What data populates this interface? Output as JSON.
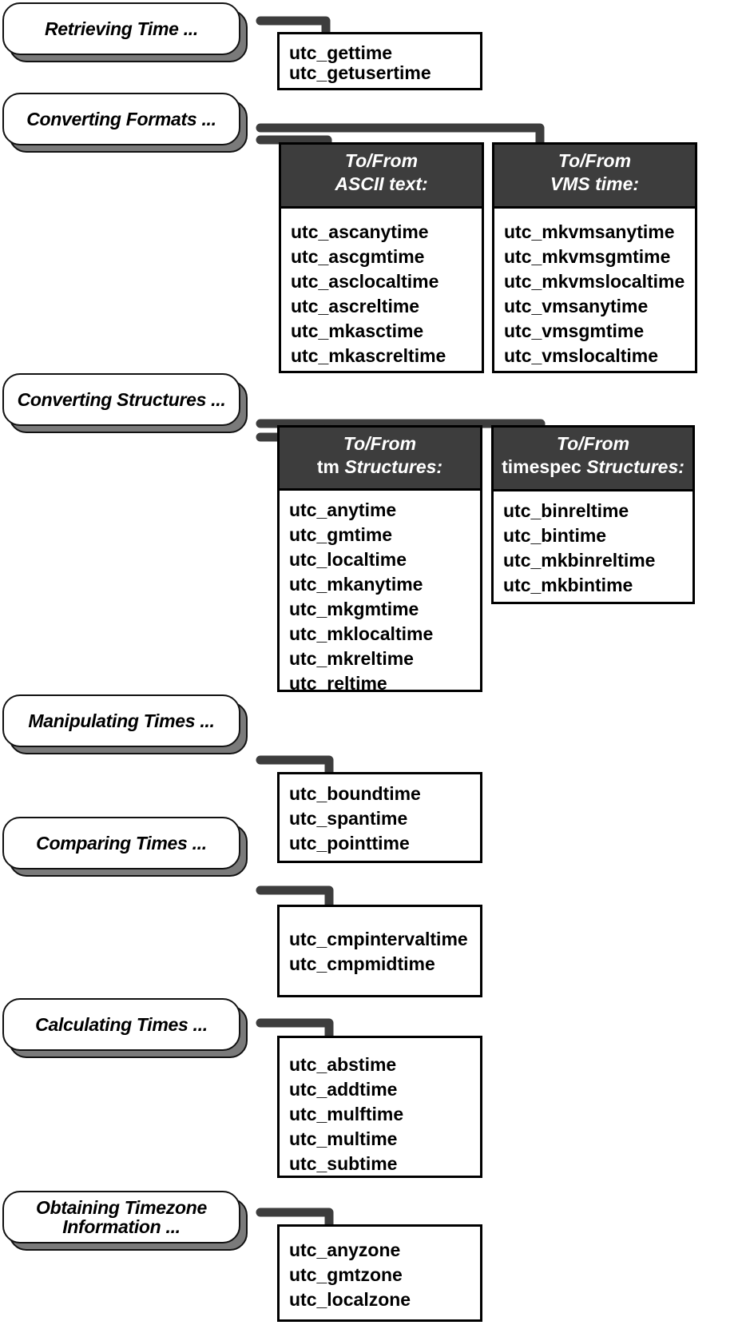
{
  "diagram": {
    "groups": [
      {
        "id": "retrieving",
        "label": "Retrieving Time ...",
        "tables": [
          {
            "header": null,
            "functions": [
              "utc_gettime",
              "utc_getusertime"
            ]
          }
        ]
      },
      {
        "id": "converting-formats",
        "label": "Converting Formats ...",
        "tables": [
          {
            "header": {
              "line1": "To/From",
              "line2_plain": "",
              "line2_italic": "ASCII text:"
            },
            "functions": [
              "utc_ascanytime",
              "utc_ascgmtime",
              "utc_asclocaltime",
              "utc_ascreltime",
              "utc_mkasctime",
              "utc_mkascreltime"
            ]
          },
          {
            "header": {
              "line1": "To/From",
              "line2_plain": "",
              "line2_italic": "VMS time:"
            },
            "functions": [
              "utc_mkvmsanytime",
              "utc_mkvmsgmtime",
              "utc_mkvmslocaltime",
              "utc_vmsanytime",
              "utc_vmsgmtime",
              "utc_vmslocaltime"
            ]
          }
        ]
      },
      {
        "id": "converting-structures",
        "label": "Converting Structures ...",
        "tables": [
          {
            "header": {
              "line1": "To/From",
              "line2_plain": "tm ",
              "line2_italic": "Structures:"
            },
            "functions": [
              "utc_anytime",
              "utc_gmtime",
              "utc_localtime",
              "utc_mkanytime",
              "utc_mkgmtime",
              "utc_mklocaltime",
              "utc_mkreltime",
              "utc_reltime"
            ]
          },
          {
            "header": {
              "line1": "To/From",
              "line2_plain": "timespec ",
              "line2_italic": "Structures:"
            },
            "functions": [
              "utc_binreltime",
              "utc_bintime",
              "utc_mkbinreltime",
              "utc_mkbintime"
            ]
          }
        ]
      },
      {
        "id": "manipulating",
        "label": "Manipulating Times ...",
        "tables": [
          {
            "header": null,
            "functions": [
              "utc_boundtime",
              "utc_spantime",
              "utc_pointtime"
            ]
          }
        ]
      },
      {
        "id": "comparing",
        "label": "Comparing Times ...",
        "tables": [
          {
            "header": null,
            "functions": [
              "utc_cmpintervaltime",
              "utc_cmpmidtime"
            ]
          }
        ]
      },
      {
        "id": "calculating",
        "label": "Calculating Times ...",
        "tables": [
          {
            "header": null,
            "functions": [
              "utc_abstime",
              "utc_addtime",
              "utc_mulftime",
              "utc_multime",
              "utc_subtime"
            ]
          }
        ]
      },
      {
        "id": "timezone",
        "label_line1": "Obtaining Timezone",
        "label_line2": "Information ...",
        "tables": [
          {
            "header": null,
            "functions": [
              "utc_anyzone",
              "utc_gmtzone",
              "utc_localzone"
            ]
          }
        ]
      }
    ],
    "colors": {
      "header_bg": "#3d3d3d",
      "connector": "#3d3d3d",
      "shadow": "#7a7a7a"
    }
  }
}
